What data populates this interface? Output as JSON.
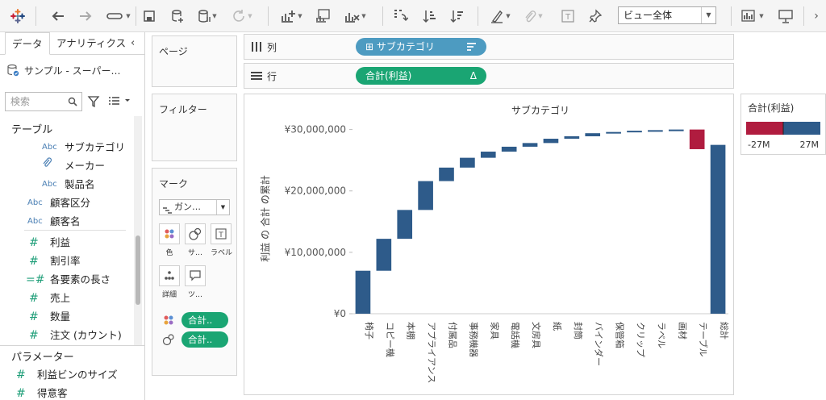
{
  "toolbar": {
    "view_select": "ビュー全体"
  },
  "data_pane": {
    "tab_data": "データ",
    "tab_analytics": "アナリティクス",
    "datasource": "サンプル - スーパー…",
    "search_placeholder": "検索",
    "tables_header": "テーブル",
    "fields": [
      {
        "icon": "Abc",
        "name": "サブカテゴリ",
        "kind": "dim"
      },
      {
        "icon": "paperclip",
        "name": "メーカー",
        "kind": "group"
      },
      {
        "icon": "Abc",
        "name": "製品名",
        "kind": "dim"
      },
      {
        "icon": "Abc",
        "name": "顧客区分",
        "kind": "dim"
      },
      {
        "icon": "Abc",
        "name": "顧客名",
        "kind": "dim"
      },
      {
        "icon": "#",
        "name": "利益",
        "kind": "measure"
      },
      {
        "icon": "#",
        "name": "割引率",
        "kind": "measure"
      },
      {
        "icon": "=#",
        "name": "各要素の長さ",
        "kind": "calc"
      },
      {
        "icon": "#",
        "name": "売上",
        "kind": "measure"
      },
      {
        "icon": "#",
        "name": "数量",
        "kind": "measure"
      },
      {
        "icon": "#",
        "name": "注文 (カウント)",
        "kind": "measure"
      }
    ],
    "parameters_header": "パラメーター",
    "parameters": [
      {
        "icon": "#",
        "name": "利益ビンのサイズ"
      },
      {
        "icon": "#",
        "name": "得意客"
      }
    ]
  },
  "cards": {
    "pages": "ページ",
    "filters": "フィルター",
    "marks": "マーク",
    "marks_type": "ガン…",
    "marks_buttons": [
      {
        "label": "色"
      },
      {
        "label": "サ…"
      },
      {
        "label": "ラベル"
      },
      {
        "label": "詳細"
      },
      {
        "label": "ツ…"
      }
    ],
    "marks_pills": [
      "合計..",
      "合計.."
    ]
  },
  "shelves": {
    "columns_label": "列",
    "columns_pill": "サブカテゴリ",
    "rows_label": "行",
    "rows_pill": "合計(利益)",
    "rows_pill_mark": "Δ"
  },
  "legend": {
    "title": "合計(利益)",
    "min": "-27M",
    "max": "27M",
    "neg_color": "#b01c3f",
    "pos_color": "#2e5b8a"
  },
  "chart_data": {
    "type": "waterfall",
    "title": "サブカテゴリ",
    "ylabel": "利益 の 合計 の累計",
    "ylim": [
      0,
      31000000
    ],
    "yticks": [
      0,
      10000000,
      20000000,
      30000000
    ],
    "ytick_labels": [
      "¥0",
      "¥10,000,000",
      "¥20,000,000",
      "¥30,000,000"
    ],
    "categories": [
      "椅子",
      "コピー機",
      "本棚",
      "アプライアンス",
      "付属品",
      "事務機器",
      "家具",
      "電話機",
      "文房具",
      "紙",
      "封筒",
      "バインダー",
      "保管箱",
      "クリップ",
      "ラベル",
      "画材",
      "テーブル",
      "総計"
    ],
    "values": [
      7000000,
      5200000,
      4700000,
      4700000,
      2200000,
      1600000,
      1000000,
      800000,
      600000,
      700000,
      400000,
      500000,
      200000,
      200000,
      100000,
      100000,
      -3200000,
      27500000
    ],
    "total_index": 17,
    "colors": {
      "positive": "#2e5b8a",
      "negative": "#b01c3f"
    }
  }
}
